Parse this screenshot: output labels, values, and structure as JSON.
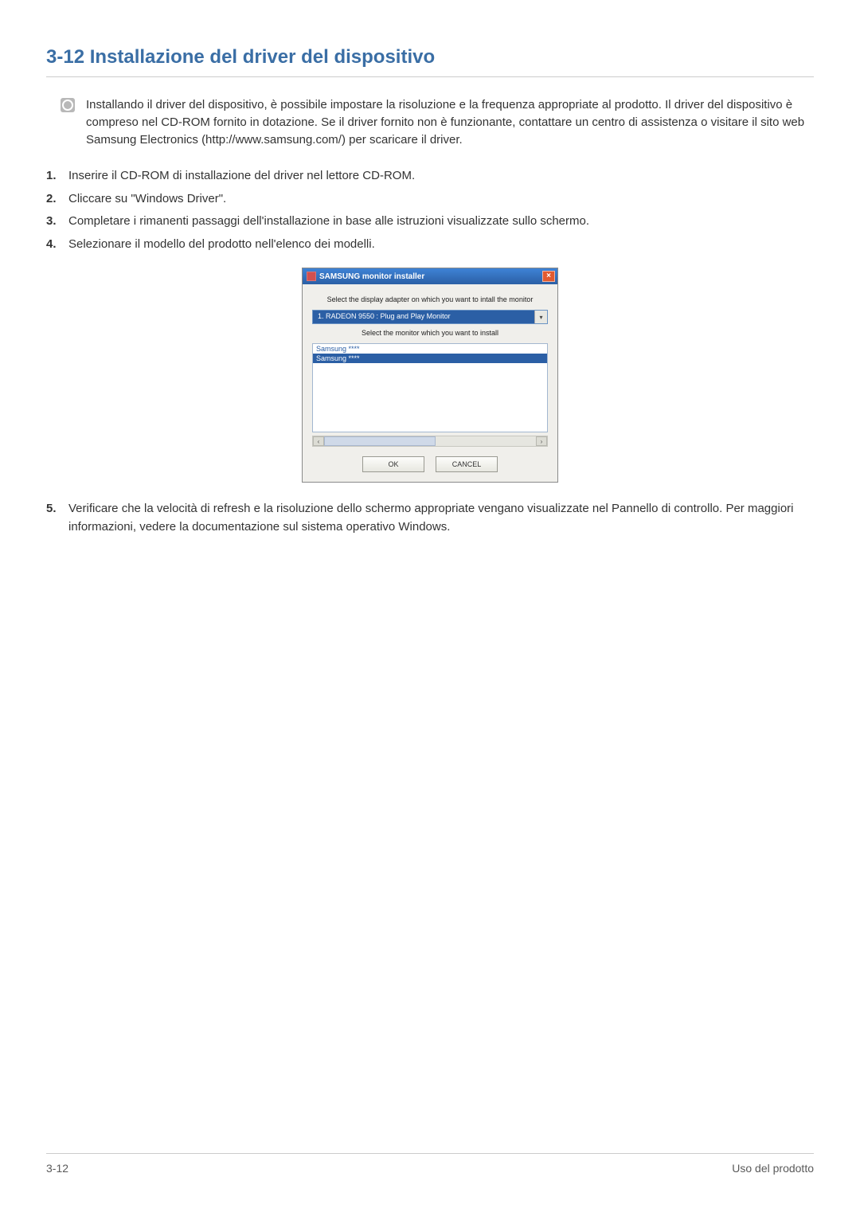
{
  "heading": "3-12   Installazione del driver del dispositivo",
  "note": "Installando il driver del dispositivo, è possibile impostare la risoluzione e la frequenza appropriate al prodotto. Il driver del dispositivo è compreso nel CD-ROM fornito in dotazione. Se il driver fornito non è funzionante, contattare un centro di assistenza o visitare il sito web Samsung Electronics (http://www.samsung.com/) per scaricare il driver.",
  "steps": [
    "Inserire il CD-ROM di installazione del driver nel lettore CD-ROM.",
    "Cliccare su \"Windows Driver\".",
    "Completare i rimanenti passaggi dell'installazione in base alle istruzioni visualizzate sullo schermo.",
    "Selezionare il modello del prodotto nell'elenco dei modelli."
  ],
  "installer": {
    "title": "SAMSUNG monitor installer",
    "label1": "Select the display adapter on which you want to intall the monitor",
    "dropdown_value": "1. RADEON 9550 : Plug and Play Monitor",
    "label2": "Select the monitor which you want to install",
    "list_item_1": "Samsung ****",
    "list_item_2": "Samsung ****",
    "ok": "OK",
    "cancel": "CANCEL",
    "close_glyph": "×",
    "chevron_glyph": "▾",
    "arrow_left": "‹",
    "arrow_right": "›"
  },
  "step5": "Verificare che la velocità di refresh e la risoluzione dello schermo appropriate vengano visualizzate nel Pannello di controllo. Per maggiori informazioni, vedere la documentazione sul sistema operativo Windows.",
  "footer_left": "3-12",
  "footer_right": "Uso del prodotto"
}
